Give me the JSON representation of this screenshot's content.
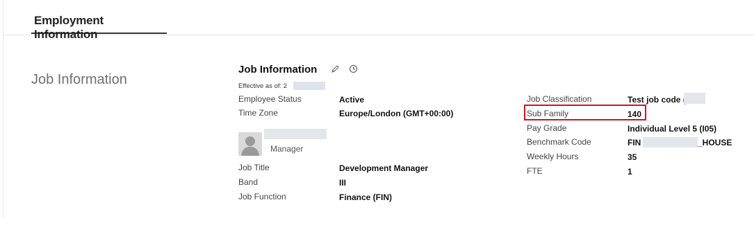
{
  "section": {
    "tab_label": "Employment Information"
  },
  "block": {
    "label": "Job Information"
  },
  "card": {
    "title": "Job Information",
    "edit_icon": "pencil-icon",
    "history_icon": "clock-icon",
    "effective_prefix": "Effective as of: 2"
  },
  "left_fields": [
    {
      "label": "Employee Status",
      "value": "Active"
    },
    {
      "label": "Time Zone",
      "value": "Europe/London (GMT+00:00)"
    }
  ],
  "manager": {
    "label": "Manager",
    "avatar_icon": "person-avatar-icon"
  },
  "left_fields_2": [
    {
      "label": "Job Title",
      "value": "Development Manager"
    },
    {
      "label": "Band",
      "value": "III"
    },
    {
      "label": "Job Function",
      "value": "Finance (FIN)"
    }
  ],
  "right_fields": [
    {
      "label": "Job Classification",
      "value": "Test job code ("
    },
    {
      "label": "Sub Family",
      "value": "140"
    },
    {
      "label": "Pay Grade",
      "value": "Individual Level 5 (I05)"
    },
    {
      "label": "Benchmark Code",
      "value_prefix": "FIN",
      "value_suffix": "_HOUSE"
    },
    {
      "label": "Weekly Hours",
      "value": "35"
    },
    {
      "label": "FTE",
      "value": "1"
    }
  ],
  "colors": {
    "highlight": "#d1121b",
    "tab_underline": "#333333",
    "redaction": "#dde3ea"
  }
}
